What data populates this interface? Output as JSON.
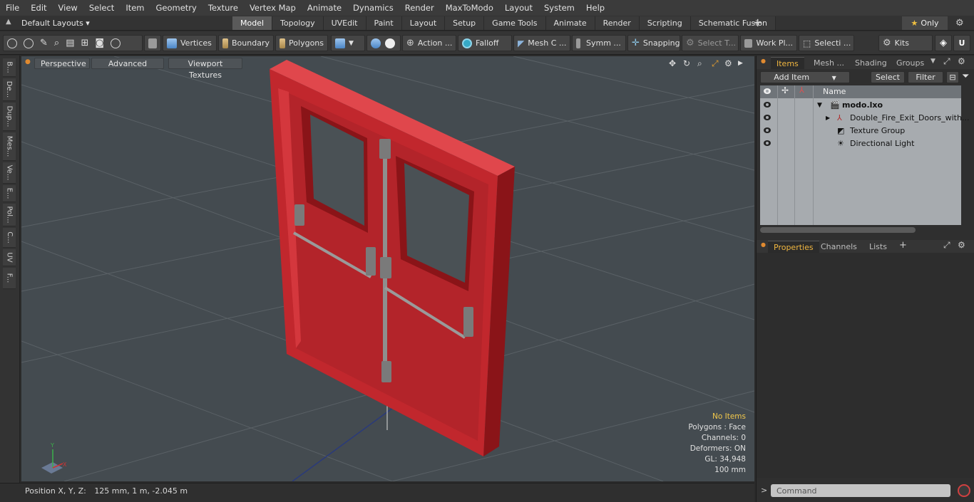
{
  "menubar": [
    "File",
    "Edit",
    "View",
    "Select",
    "Item",
    "Geometry",
    "Texture",
    "Vertex Map",
    "Animate",
    "Dynamics",
    "Render",
    "MaxToModo",
    "Layout",
    "System",
    "Help"
  ],
  "layoutbar": {
    "layouts_label": "Default Layouts ▾",
    "tabs": [
      "Model",
      "Topology",
      "UVEdit",
      "Paint",
      "Layout",
      "Setup",
      "Game Tools",
      "Animate",
      "Render",
      "Scripting",
      "Schematic Fusion"
    ],
    "active_tab": "Model",
    "plus": "+",
    "only_label": "Only"
  },
  "toolbar": {
    "vertices": "Vertices",
    "boundary": "Boundary",
    "polygons": "Polygons",
    "action": "Action ...",
    "falloff": "Falloff",
    "mesh_c": "Mesh C ...",
    "symm": "Symm ...",
    "snapping": "Snapping",
    "select_t": "Select T...",
    "work_pl": "Work Pl...",
    "selecti": "Selecti ...",
    "kits": "Kits"
  },
  "left_tabs": [
    "B...",
    "De...",
    "Dup...",
    "Mes...",
    "Ve...",
    "E...",
    "Pol...",
    "C...",
    "UV",
    "F..."
  ],
  "viewport": {
    "buttons": [
      "Perspective",
      "Advanced",
      "Viewport Textures"
    ],
    "stats": {
      "items": "No Items",
      "polygons": "Polygons : Face",
      "channels": "Channels: 0",
      "deformers": "Deformers: ON",
      "gl": "GL: 34,948",
      "unit": "100 mm"
    },
    "axis_labels": {
      "x": "X",
      "y": "Y"
    }
  },
  "statusbar": {
    "label": "Position X, Y, Z:",
    "value": "125 mm, 1 m, -2.045 m"
  },
  "items_panel": {
    "tabs": [
      "Items",
      "Mesh ...",
      "Shading",
      "Groups"
    ],
    "active_tab": "Items",
    "add_item": "Add Item",
    "select": "Select",
    "filter": "Filter",
    "column_name": "Name",
    "rows": [
      {
        "name": "modo.lxo"
      },
      {
        "name": "Double_Fire_Exit_Doors_with..."
      },
      {
        "name": "Texture Group"
      },
      {
        "name": "Directional Light"
      }
    ]
  },
  "props_panel": {
    "tabs": [
      "Properties",
      "Channels",
      "Lists"
    ],
    "active_tab": "Properties",
    "plus": "+"
  },
  "command": {
    "placeholder": "Command",
    "prompt": ">"
  },
  "colors": {
    "accent": "#f0b640",
    "door_red": "#c1272d",
    "viewport_bg": "#444b50"
  }
}
